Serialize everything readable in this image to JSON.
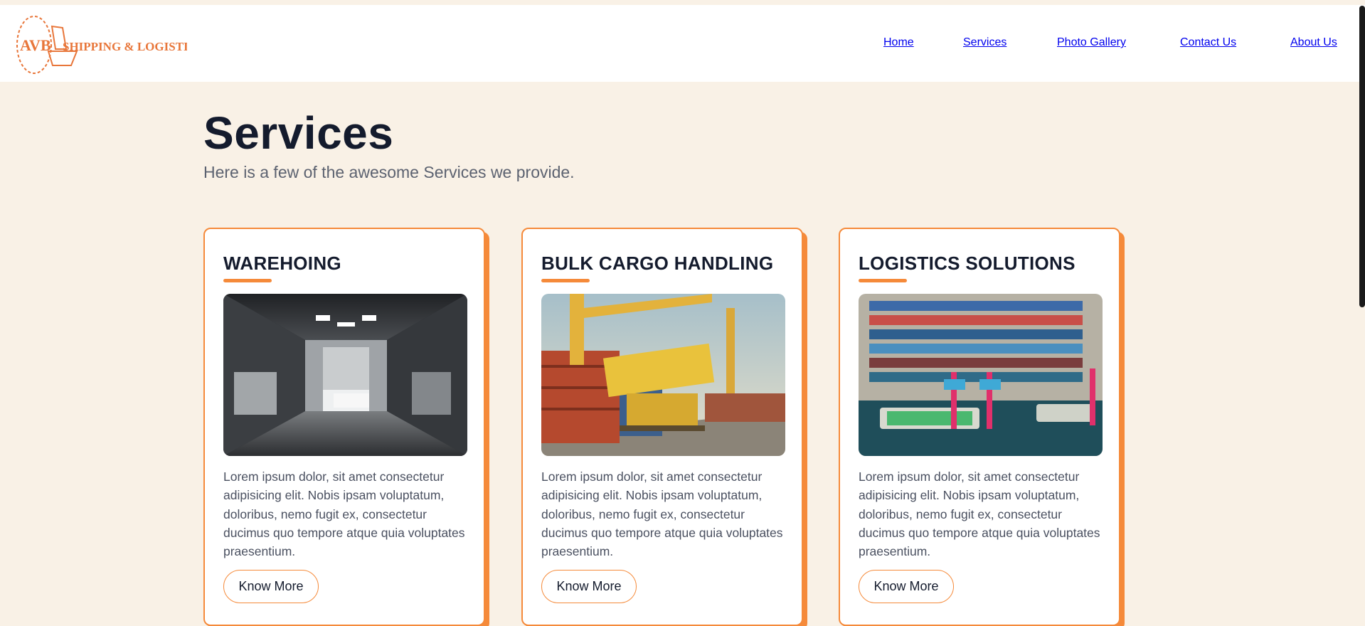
{
  "header": {
    "logo": {
      "text_avb": "AVB",
      "text_name": "SHIPPING & LOGISTICS"
    },
    "nav": [
      {
        "label": "Home"
      },
      {
        "label": "Services"
      },
      {
        "label": "Photo Gallery"
      },
      {
        "label": "Contact Us"
      },
      {
        "label": "About Us"
      }
    ]
  },
  "main": {
    "title": "Services",
    "subtitle": "Here is a few of the awesome Services we provide.",
    "cards": [
      {
        "title": "WAREHOING",
        "image_alt": "warehouse-interior-image",
        "text": "Lorem ipsum dolor, sit amet consectetur adipisicing elit. Nobis ipsam voluptatum, doloribus, nemo fugit ex, consectetur ducimus quo tempore atque quia voluptates praesentium.",
        "button": "Know More"
      },
      {
        "title": "BULK CARGO HANDLING",
        "image_alt": "container-crane-image",
        "text": "Lorem ipsum dolor, sit amet consectetur adipisicing elit. Nobis ipsam voluptatum, doloribus, nemo fugit ex, consectetur ducimus quo tempore atque quia voluptates praesentium.",
        "button": "Know More"
      },
      {
        "title": "LOGISTICS SOLUTIONS",
        "image_alt": "port-aerial-image",
        "text": "Lorem ipsum dolor, sit amet consectetur adipisicing elit. Nobis ipsam voluptatum, doloribus, nemo fugit ex, consectetur ducimus quo tempore atque quia voluptates praesentium.",
        "button": "Know More"
      }
    ]
  },
  "colors": {
    "accent": "#f58a3a",
    "background": "#f9f1e6",
    "heading": "#141b2d",
    "body_text": "#4a5060"
  }
}
